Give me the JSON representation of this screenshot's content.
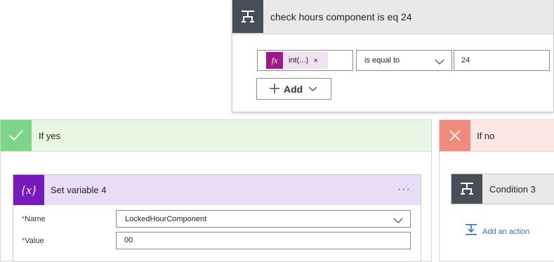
{
  "condition": {
    "title": "check hours component is eq 24",
    "token": {
      "icon_text": "fx",
      "label": "int(...)",
      "remove": "×"
    },
    "operator": "is equal to",
    "value": "24",
    "add_label": "Add",
    "icons": [
      "condition-icon",
      "plus-icon",
      "chevron-down-icon",
      "fx-icon",
      "close-icon"
    ]
  },
  "yes_branch": {
    "title": "If yes",
    "icon": "checkmark-icon",
    "color": "#7cd68a",
    "set_variable": {
      "title": "Set variable 4",
      "icon_text": "{x}",
      "more": "···",
      "name_label": "Name",
      "name_value": "LockedHourComponent",
      "value_label": "Value",
      "value_value": "00",
      "required_marker": "*",
      "color": "#7719bd"
    }
  },
  "no_branch": {
    "title": "If no",
    "icon": "cross-icon",
    "color": "#f08b7e",
    "condition3_title": "Condition 3",
    "add_action_label": "Add an action"
  }
}
